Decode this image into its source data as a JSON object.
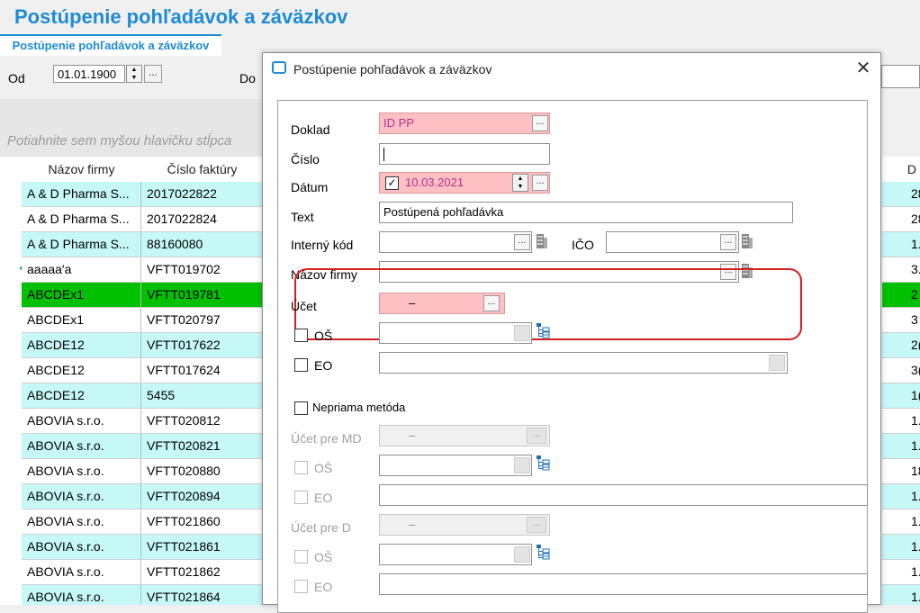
{
  "app": {
    "title": "Postúpenie pohľadávok a záväzkov",
    "tab": "Postúpenie pohľadávok a záväzkov"
  },
  "filter": {
    "od_label": "Od",
    "od_value": "01.01.1900",
    "do_label": "Do",
    "dots": "..."
  },
  "grid": {
    "group_hint": "Potiahnite sem myšou hlavičku stĺpca",
    "columns": [
      "Názov firmy",
      "Číslo faktúry"
    ],
    "rows": [
      {
        "firm": "A & D Pharma S...",
        "invoice": "2017022822",
        "right": "28",
        "color": "#c6f8f8"
      },
      {
        "firm": "A & D Pharma S...",
        "invoice": "2017022824",
        "right": "28",
        "color": "#ffffff"
      },
      {
        "firm": "A & D Pharma S...",
        "invoice": "88160080",
        "right": "1.",
        "color": "#c6f8f8"
      },
      {
        "firm": "aaaaa'a",
        "invoice": "VFTT019702",
        "right": "3.",
        "color": "#ffffff"
      },
      {
        "firm": "ABCDEx1",
        "invoice": "VFTT019781",
        "right": "2",
        "color": "#00c000"
      },
      {
        "firm": "ABCDEx1",
        "invoice": "VFTT020797",
        "right": "3",
        "color": "#ffffff"
      },
      {
        "firm": "ABCDE12",
        "invoice": "VFTT017622",
        "right": "2(",
        "color": "#c6f8f8"
      },
      {
        "firm": "ABCDE12",
        "invoice": "VFTT017624",
        "right": "3(",
        "color": "#ffffff"
      },
      {
        "firm": "ABCDE12",
        "invoice": "5455",
        "right": "1(",
        "color": "#c6f8f8"
      },
      {
        "firm": "ABOVIA s.r.o.",
        "invoice": "VFTT020812",
        "right": "1.",
        "color": "#ffffff"
      },
      {
        "firm": "ABOVIA s.r.o.",
        "invoice": "VFTT020821",
        "right": "1.",
        "color": "#c6f8f8"
      },
      {
        "firm": "ABOVIA s.r.o.",
        "invoice": "VFTT020880",
        "right": "18",
        "color": "#ffffff"
      },
      {
        "firm": "ABOVIA s.r.o.",
        "invoice": "VFTT020894",
        "right": "1.",
        "color": "#c6f8f8"
      },
      {
        "firm": "ABOVIA s.r.o.",
        "invoice": "VFTT021860",
        "right": "1.",
        "color": "#ffffff"
      },
      {
        "firm": "ABOVIA s.r.o.",
        "invoice": "VFTT021861",
        "right": "1.",
        "color": "#c6f8f8"
      },
      {
        "firm": "ABOVIA s.r.o.",
        "invoice": "VFTT021862",
        "right": "1.",
        "color": "#ffffff"
      },
      {
        "firm": "ABOVIA s.r.o.",
        "invoice": "VFTT021864",
        "right": "1.",
        "color": "#c6f8f8"
      }
    ],
    "right_header": "D"
  },
  "dialog": {
    "title": "Postúpenie pohľadávok a záväzkov",
    "close": "✕",
    "doklad_label": "Doklad",
    "doklad_value": "ID PP",
    "cislo_label": "Číslo",
    "datum_label": "Dátum",
    "datum_value": "10.03.2021",
    "text_label": "Text",
    "text_value": "Postúpená pohľadávka",
    "interny_kod_label": "Interný kód",
    "ico_label": "IČO",
    "nazov_firmy_label": "Názov firmy",
    "ucet_label": "Účet",
    "ucet_value": "–",
    "os_label": "OŠ",
    "eo_label": "EO",
    "nepriama_label": "Nepriama metóda",
    "ucet_md_label": "Účet pre MD",
    "ucet_md_value": "–",
    "ucet_d_label": "Účet pre D",
    "ucet_d_value": "–",
    "dots": "..."
  }
}
